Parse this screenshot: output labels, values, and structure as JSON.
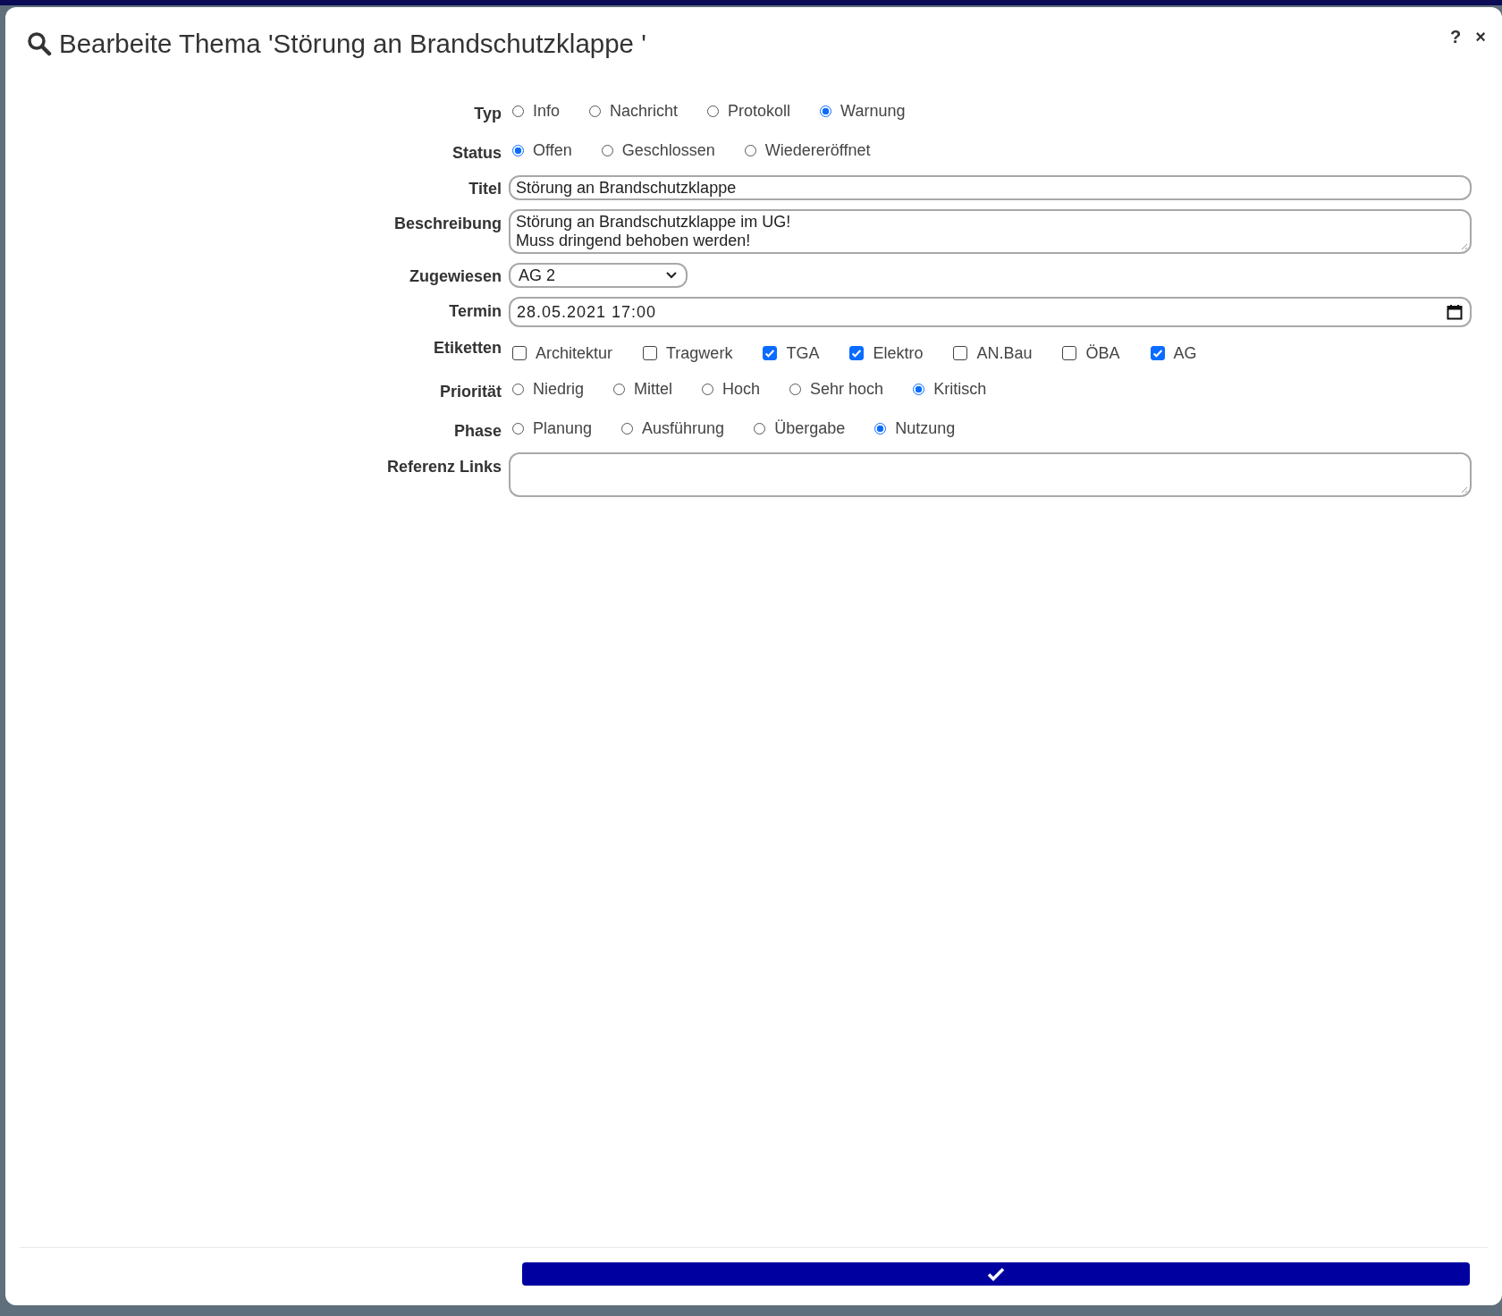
{
  "dialog": {
    "title": "Bearbeite Thema 'Störung an Brandschutzklappe '",
    "help_button": "?",
    "close_button": "×"
  },
  "fields": [
    {
      "kind": "radio",
      "label": "Typ",
      "options": [
        {
          "label": "Info",
          "selected": false
        },
        {
          "label": "Nachricht",
          "selected": false
        },
        {
          "label": "Protokoll",
          "selected": false
        },
        {
          "label": "Warnung",
          "selected": true
        }
      ]
    },
    {
      "kind": "radio",
      "label": "Status",
      "options": [
        {
          "label": "Offen",
          "selected": true
        },
        {
          "label": "Geschlossen",
          "selected": false
        },
        {
          "label": "Wiedereröffnet",
          "selected": false
        }
      ]
    },
    {
      "kind": "text",
      "label": "Titel",
      "value": "Störung an Brandschutzklappe"
    },
    {
      "kind": "textarea",
      "label": "Beschreibung",
      "value": "Störung an Brandschutzklappe im UG!\nMuss dringend behoben werden!"
    },
    {
      "kind": "select",
      "label": "Zugewiesen",
      "value": "AG 2"
    },
    {
      "kind": "datetime",
      "label": "Termin",
      "value": "28.05.2021  17:00"
    },
    {
      "kind": "checkbox",
      "label": "Etiketten",
      "options": [
        {
          "label": "Architektur",
          "checked": false
        },
        {
          "label": "Tragwerk",
          "checked": false
        },
        {
          "label": "TGA",
          "checked": true
        },
        {
          "label": "Elektro",
          "checked": true
        },
        {
          "label": "AN.Bau",
          "checked": false
        },
        {
          "label": "ÖBA",
          "checked": false
        },
        {
          "label": "AG",
          "checked": true
        }
      ]
    },
    {
      "kind": "radio",
      "label": "Priorität",
      "options": [
        {
          "label": "Niedrig",
          "selected": false
        },
        {
          "label": "Mittel",
          "selected": false
        },
        {
          "label": "Hoch",
          "selected": false
        },
        {
          "label": "Sehr hoch",
          "selected": false
        },
        {
          "label": "Kritisch",
          "selected": true
        }
      ]
    },
    {
      "kind": "radio",
      "label": "Phase",
      "options": [
        {
          "label": "Planung",
          "selected": false
        },
        {
          "label": "Ausführung",
          "selected": false
        },
        {
          "label": "Übergabe",
          "selected": false
        },
        {
          "label": "Nutzung",
          "selected": true
        }
      ]
    },
    {
      "kind": "textarea",
      "label": "Referenz Links"
    }
  ]
}
